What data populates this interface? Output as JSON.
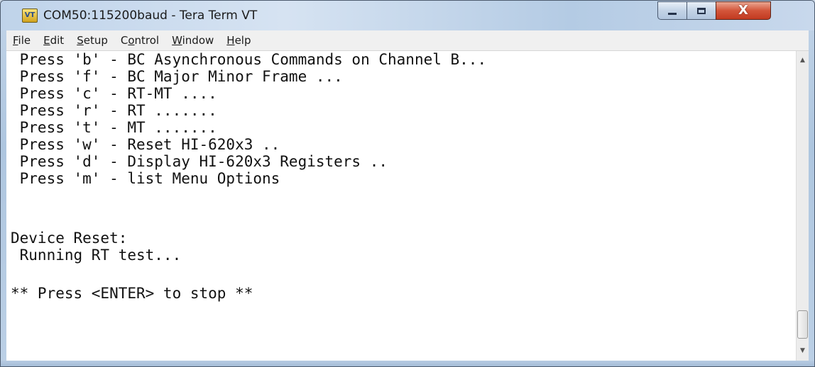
{
  "window": {
    "title": "COM50:115200baud - Tera Term VT",
    "icon_label": "VT",
    "icon": "teraterm-app-icon"
  },
  "controls": {
    "minimize_icon": "minimize-icon",
    "maximize_icon": "maximize-icon",
    "close_icon": "close-icon",
    "close_glyph": "X"
  },
  "menu": [
    {
      "key": "F",
      "rest": "ile"
    },
    {
      "key": "E",
      "rest": "dit"
    },
    {
      "key": "S",
      "rest": "etup"
    },
    {
      "pre": "C",
      "key": "o",
      "rest": "ntrol"
    },
    {
      "key": "W",
      "rest": "indow"
    },
    {
      "key": "H",
      "rest": "elp"
    }
  ],
  "terminal": {
    "lines": [
      " Press 'b' - BC Asynchronous Commands on Channel B...",
      " Press 'f' - BC Major Minor Frame ...",
      " Press 'c' - RT-MT ....",
      " Press 'r' - RT .......",
      " Press 't' - MT .......",
      " Press 'w' - Reset HI-620x3 ..",
      " Press 'd' - Display HI-620x3 Registers ..",
      " Press 'm' - list Menu Options",
      "",
      "",
      "Device Reset:",
      " Running RT test...",
      "",
      "** Press <ENTER> to stop **"
    ]
  },
  "scrollbar": {
    "up_glyph": "▲",
    "down_glyph": "▼"
  }
}
